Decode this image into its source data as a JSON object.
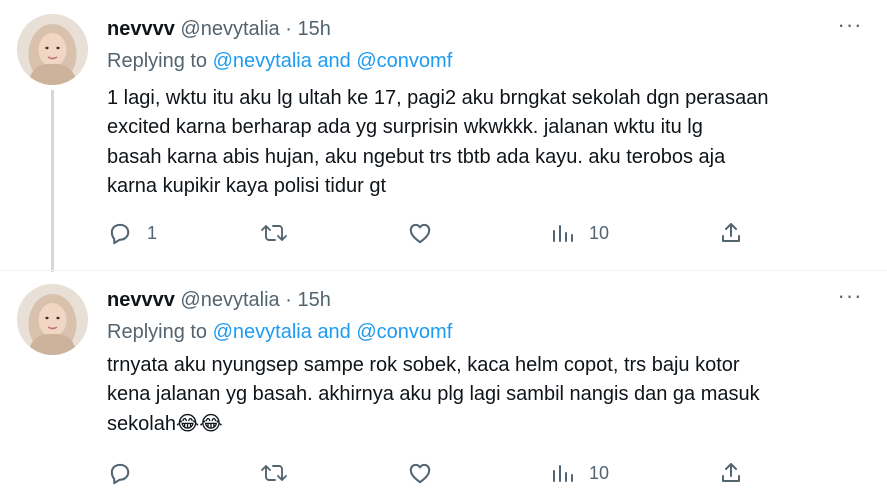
{
  "tweets": [
    {
      "name": "nevvvv",
      "handle": "@nevytalia",
      "separator": "·",
      "time": "15h",
      "replying_prefix": "Replying to",
      "mention_1": "@nevytalia",
      "and_word": "and",
      "mention_2": "@convomf",
      "text_lines": [
        "1 lagi, wktu itu aku lg ultah ke 17, pagi2 aku brngkat sekolah dgn perasaan",
        "excited karna berharap ada yg surprisin wkwkkk. jalanan wktu itu lg",
        "basah karna abis hujan, aku ngebut trs tbtb ada kayu. aku terobos aja",
        "karna kupikir kaya polisi tidur gt"
      ],
      "reply_count": "1",
      "retweet_count": "",
      "like_count": "",
      "view_count": "10",
      "more_label": "···"
    },
    {
      "name": "nevvvv",
      "handle": "@nevytalia",
      "separator": "·",
      "time": "15h",
      "replying_prefix": "Replying to",
      "mention_1": "@nevytalia",
      "and_word": "and",
      "mention_2": "@convomf",
      "text_lines": [
        "trnyata aku nyungsep sampe rok sobek, kaca helm copot, trs baju kotor",
        "kena jalanan yg basah. akhirnya aku plg lagi sambil nangis dan ga masuk",
        "sekolah😂😂"
      ],
      "reply_count": "",
      "retweet_count": "",
      "like_count": "",
      "view_count": "10",
      "more_label": "···"
    }
  ],
  "colors": {
    "text": "#0f1419",
    "secondary": "#536471",
    "link": "#1d9bf0",
    "thread_line": "#cfd9de"
  },
  "icons": [
    "reply-icon",
    "retweet-icon",
    "like-icon",
    "views-icon",
    "share-icon",
    "more-icon"
  ]
}
